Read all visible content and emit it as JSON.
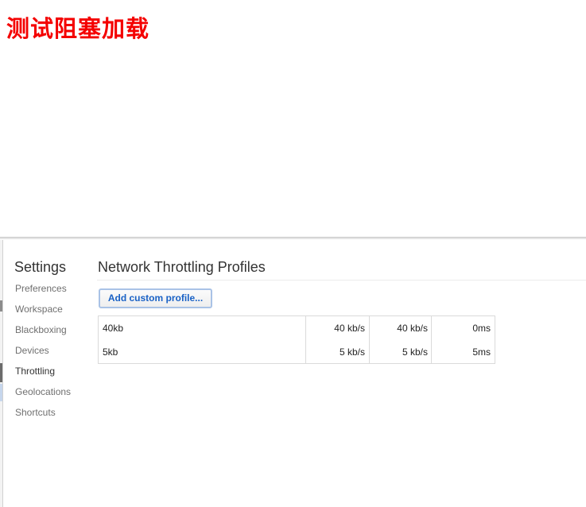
{
  "page": {
    "heading": "测试阻塞加载"
  },
  "settings": {
    "title": "Settings",
    "nav": [
      {
        "label": "Preferences",
        "selected": false
      },
      {
        "label": "Workspace",
        "selected": false
      },
      {
        "label": "Blackboxing",
        "selected": false
      },
      {
        "label": "Devices",
        "selected": false
      },
      {
        "label": "Throttling",
        "selected": true
      },
      {
        "label": "Geolocations",
        "selected": false
      },
      {
        "label": "Shortcuts",
        "selected": false
      }
    ]
  },
  "throttling": {
    "title": "Network Throttling Profiles",
    "add_button": "Add custom profile...",
    "profiles": [
      {
        "name": "40kb",
        "download": "40 kb/s",
        "upload": "40 kb/s",
        "latency": "0ms"
      },
      {
        "name": "5kb",
        "download": "5 kb/s",
        "upload": "5 kb/s",
        "latency": "5ms"
      }
    ]
  },
  "colors": {
    "heading": "#f40000",
    "accent": "#1a62c6"
  }
}
